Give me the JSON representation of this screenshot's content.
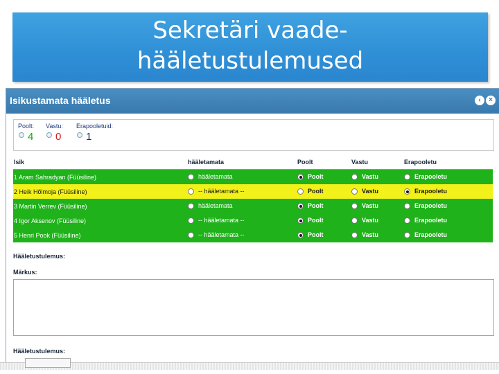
{
  "slide": {
    "title_line1": "Sekretäri vaade-",
    "title_line2": "hääletustulemused"
  },
  "window": {
    "title": "Isikustamata hääletus"
  },
  "summary": {
    "poolt_label": "Poolt:",
    "poolt_value": "4",
    "vastu_label": "Vastu:",
    "vastu_value": "0",
    "erapooletu_label": "Erapooletuid:",
    "erapooletu_value": "1",
    "colors": {
      "poolt": "#1aa81a",
      "vastu": "#d81818",
      "erapooletu": "#1a2a6a"
    }
  },
  "table": {
    "headers": [
      "Isik",
      "hääletamata",
      "Poolt",
      "Vastu",
      "Erapooletu"
    ],
    "rows": [
      {
        "name": "1 Aram Sahradyan (Füüsiline)",
        "h1": "hääletamata",
        "h2": "Poolt",
        "h3": "Vastu",
        "h4": "Erapooletu",
        "selected": 1,
        "color": "green"
      },
      {
        "name": "2 Heik Hõlmoja (Füüsiline)",
        "h1": "-- hääletamata --",
        "h2": "Poolt",
        "h3": "Vastu",
        "h4": "Erapooletu",
        "selected": 3,
        "color": "yellow"
      },
      {
        "name": "3 Martin Verrev (Füüsiline)",
        "h1": "hääletamata",
        "h2": "Poolt",
        "h3": "Vastu",
        "h4": "Erapooletu",
        "selected": 1,
        "color": "green"
      },
      {
        "name": "4 Igor Aksenov (Füüsiline)",
        "h1": "-- hääletamata --",
        "h2": "Poolt",
        "h3": "Vastu",
        "h4": "Erapooletu",
        "selected": 1,
        "color": "green"
      },
      {
        "name": "5 Henri Pook (Füüsiline)",
        "h1": "-- hääletamata --",
        "h2": "Poolt",
        "h3": "Vastu",
        "h4": "Erapooletu",
        "selected": 1,
        "color": "green"
      }
    ]
  },
  "form": {
    "result_label": "Hääletustulemus:",
    "remarks_label": "Märkus:",
    "result_label_2": "Hääletustulemus:"
  }
}
